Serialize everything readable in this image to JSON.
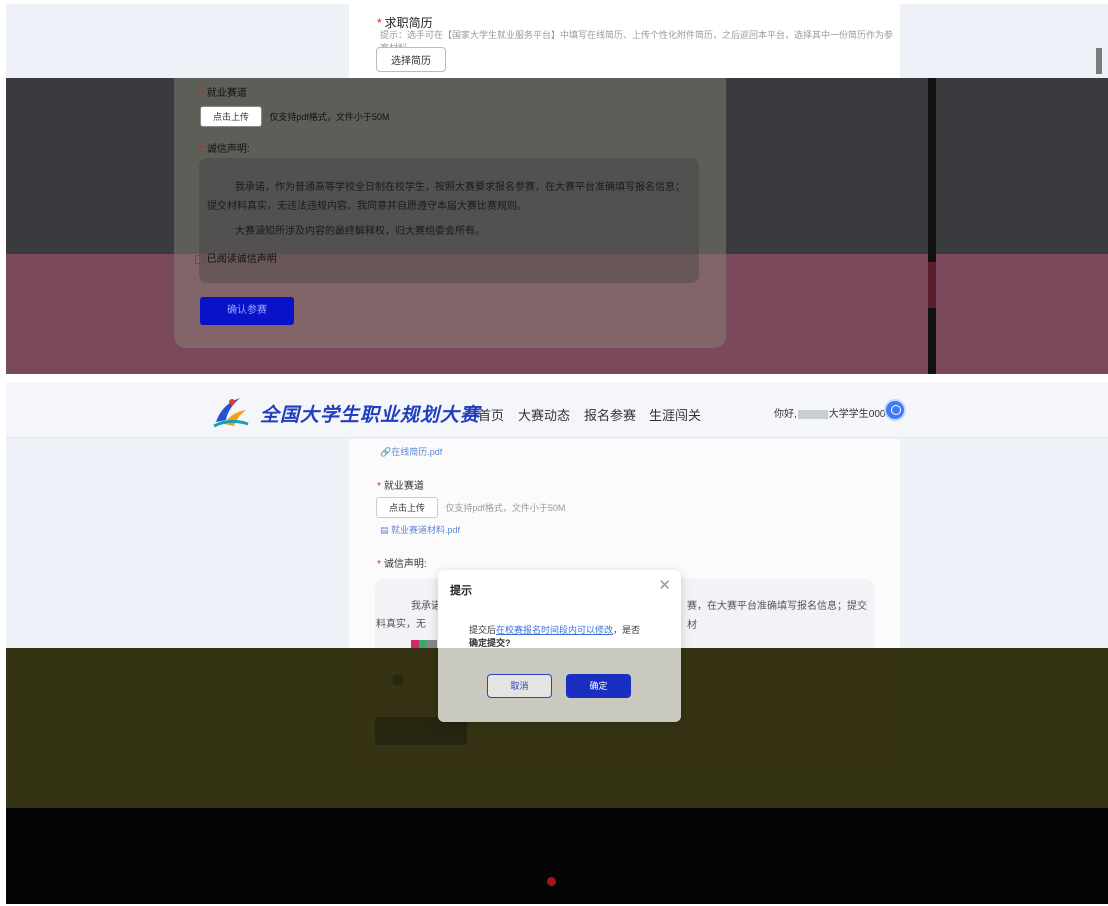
{
  "top_panel": {
    "resume_section": {
      "title": "求职简历",
      "hint": "提示：选手可在【国家大学生就业服务平台】中填写在线简历、上传个性化附件简历，之后返回本平台，选择其中一份简历作为参赛材料。",
      "select_button": "选择简历"
    },
    "track_section": {
      "title": "就业赛道",
      "upload_button": "点击上传",
      "upload_hint": "仅支持pdf格式，文件小于50M"
    },
    "declaration": {
      "title": "诚信声明:",
      "para1": "我承诺，作为普通高等学校全日制在校学生，按照大赛要求报名参赛，在大赛平台准确填写报名信息；提交材料真实，无违法违规内容。我同意并自愿遵守本届大赛比赛规则。",
      "para2": "大赛涵知所涉及内容的最终解释权，归大赛组委会所有。",
      "checkbox_label": "已阅读诚信声明"
    },
    "confirm_button": "确认参赛"
  },
  "bottom_panel": {
    "nav": {
      "brand": "全国大学生职业规划大赛",
      "links": [
        "首页",
        "大赛动态",
        "报名参赛",
        "生涯闯关"
      ],
      "greeting_prefix": "你好,",
      "greeting_user": "大学学生0001"
    },
    "resume_file": "在线简历.pdf",
    "track_section": {
      "title": "就业赛道",
      "upload_button": "点击上传",
      "upload_hint": "仅支持pdf格式，文件小于50M",
      "file": "就业赛道材料.pdf"
    },
    "declaration": {
      "title": "诚信声明:",
      "line1_left": "我承诺",
      "line1_right": "赛，在大赛平台准确填写报名信息；提交材",
      "line2_left": "料真实，无"
    },
    "dialog": {
      "title": "提示",
      "close": "✕",
      "msg_pre": "提交后",
      "msg_link": "在校赛报名时间段内可以修改",
      "msg_post": "，是否",
      "msg_bold": "确定提交?",
      "cancel": "取消",
      "ok": "确定"
    }
  },
  "colors": {
    "brand_blue": "#1f3ec0",
    "confirm_blue": "#0a12c8",
    "link_blue": "#3a6fdc",
    "required_red": "#e02020"
  }
}
